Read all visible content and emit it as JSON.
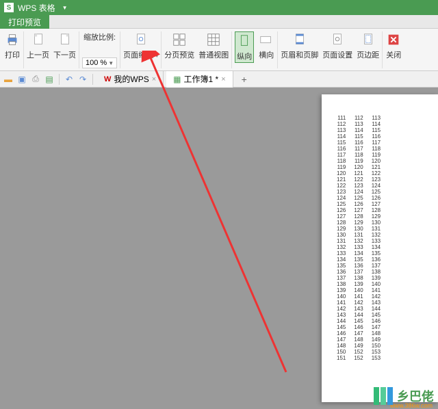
{
  "app": {
    "name": "WPS 表格"
  },
  "tabs": {
    "preview": "打印预览"
  },
  "ribbon": {
    "print": "打印",
    "prev_page": "上一页",
    "next_page": "下一页",
    "zoom_label": "缩放比例:",
    "zoom_value": "100 %",
    "page_zoom": "页面缩放",
    "page_break": "分页预览",
    "normal_view": "普通视图",
    "portrait": "纵向",
    "landscape": "横向",
    "header_footer": "页眉和页脚",
    "page_setup": "页面设置",
    "margins": "页边距",
    "close": "关闭"
  },
  "doctabs": {
    "mywps": "我的WPS",
    "workbook": "工作簿1 *"
  },
  "watermark": {
    "text": "乡巴佬",
    "url": "www.386w.com"
  },
  "chart_data": {
    "type": "table",
    "title": "",
    "columns": 4,
    "rows": [
      [
        111,
        112,
        113,
        ""
      ],
      [
        112,
        113,
        114,
        ""
      ],
      [
        113,
        114,
        115,
        ""
      ],
      [
        114,
        115,
        116,
        ""
      ],
      [
        115,
        116,
        117,
        ""
      ],
      [
        116,
        117,
        118,
        ""
      ],
      [
        117,
        118,
        119,
        ""
      ],
      [
        118,
        119,
        120,
        ""
      ],
      [
        119,
        120,
        121,
        ""
      ],
      [
        120,
        121,
        122,
        ""
      ],
      [
        121,
        122,
        123,
        ""
      ],
      [
        122,
        123,
        124,
        ""
      ],
      [
        123,
        124,
        125,
        ""
      ],
      [
        124,
        125,
        126,
        ""
      ],
      [
        125,
        126,
        127,
        ""
      ],
      [
        126,
        127,
        128,
        ""
      ],
      [
        127,
        128,
        129,
        ""
      ],
      [
        128,
        129,
        130,
        ""
      ],
      [
        129,
        130,
        131,
        ""
      ],
      [
        130,
        131,
        132,
        ""
      ],
      [
        131,
        132,
        133,
        ""
      ],
      [
        132,
        133,
        134,
        ""
      ],
      [
        133,
        134,
        135,
        ""
      ],
      [
        134,
        135,
        136,
        ""
      ],
      [
        135,
        136,
        137,
        ""
      ],
      [
        136,
        137,
        138,
        ""
      ],
      [
        137,
        138,
        139,
        ""
      ],
      [
        138,
        139,
        140,
        ""
      ],
      [
        139,
        140,
        141,
        ""
      ],
      [
        140,
        141,
        142,
        ""
      ],
      [
        141,
        142,
        143,
        ""
      ],
      [
        142,
        143,
        144,
        ""
      ],
      [
        143,
        144,
        145,
        ""
      ],
      [
        144,
        145,
        146,
        ""
      ],
      [
        145,
        146,
        147,
        ""
      ],
      [
        146,
        147,
        148,
        ""
      ],
      [
        147,
        148,
        149,
        ""
      ],
      [
        148,
        149,
        150,
        ""
      ],
      [
        150,
        152,
        153,
        ""
      ],
      [
        151,
        152,
        153,
        ""
      ]
    ]
  }
}
